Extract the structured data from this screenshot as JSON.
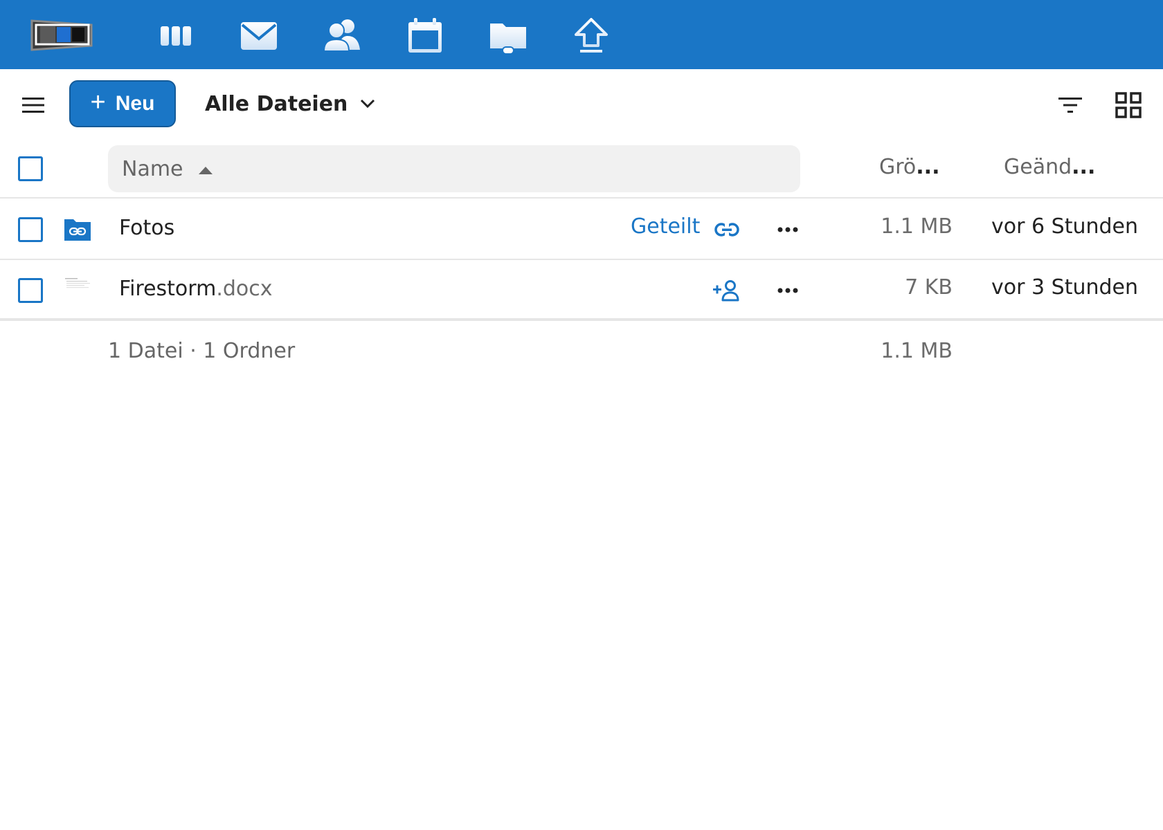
{
  "header": {
    "apps": [
      {
        "name": "dashboard",
        "icon": "dashboard-icon"
      },
      {
        "name": "mail",
        "icon": "mail-icon"
      },
      {
        "name": "contacts",
        "icon": "contacts-icon"
      },
      {
        "name": "calendar",
        "icon": "calendar-icon"
      },
      {
        "name": "files",
        "icon": "folder-icon"
      },
      {
        "name": "upload",
        "icon": "upload-icon"
      }
    ],
    "accent_color": "#1a76c6"
  },
  "toolbar": {
    "new_label": "Neu",
    "breadcrumb_label": "Alle Dateien"
  },
  "table": {
    "headers": {
      "name": "Name",
      "size": "Grö",
      "size_ellipsis": "...",
      "modified": "Geänd",
      "modified_ellipsis": "..."
    },
    "rows": [
      {
        "name": "Fotos",
        "extension": "",
        "type": "folder",
        "share_label": "Geteilt",
        "share_icon": "link-icon",
        "size": "1.1 MB",
        "modified": "vor 6 Stunden"
      },
      {
        "name": "Firestorm",
        "extension": ".docx",
        "type": "document",
        "share_label": "",
        "share_icon": "add-user-icon",
        "size": "7 KB",
        "modified": "vor 3 Stunden"
      }
    ]
  },
  "summary": {
    "text": "1 Datei · 1 Ordner",
    "size": "1.1 MB"
  }
}
